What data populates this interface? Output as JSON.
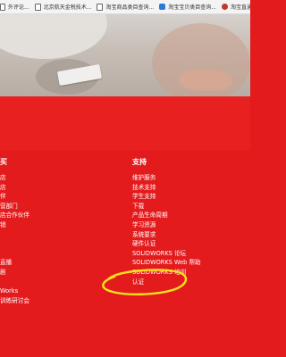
{
  "bookmarks": [
    {
      "label": "外评论...",
      "icon": "page-icon"
    },
    {
      "label": "北京航天金税技术...",
      "icon": "page-icon"
    },
    {
      "label": "淘宝商品类目查询...",
      "icon": "page-icon"
    },
    {
      "label": "淘宝宝贝类目查询...",
      "icon": "taobao-icon"
    },
    {
      "label": "淘宝直通车",
      "icon": "red-logo-icon"
    },
    {
      "label": "件",
      "icon": "folder-icon"
    }
  ],
  "footer": {
    "left_title": "买",
    "left_items": [
      "店",
      "店",
      "伴",
      "营部门",
      "店合作伙伴",
      "销",
      "",
      "",
      "",
      "直播",
      "剧",
      "",
      "Works",
      "训练研讨会"
    ],
    "right_title": "支持",
    "right_items": [
      "维护服务",
      "技术支持",
      "学生支持",
      "下载",
      "产品生命周期",
      "学习资源",
      "系统要求",
      "硬件认证",
      "SOLIDWORKS 论坛",
      "SOLIDWORKS Web 帮助",
      "SOLIDWORKS 培训",
      "认证"
    ]
  },
  "colors": {
    "brand_red": "#e41b1d",
    "annotation_yellow": "#f4e21a"
  }
}
